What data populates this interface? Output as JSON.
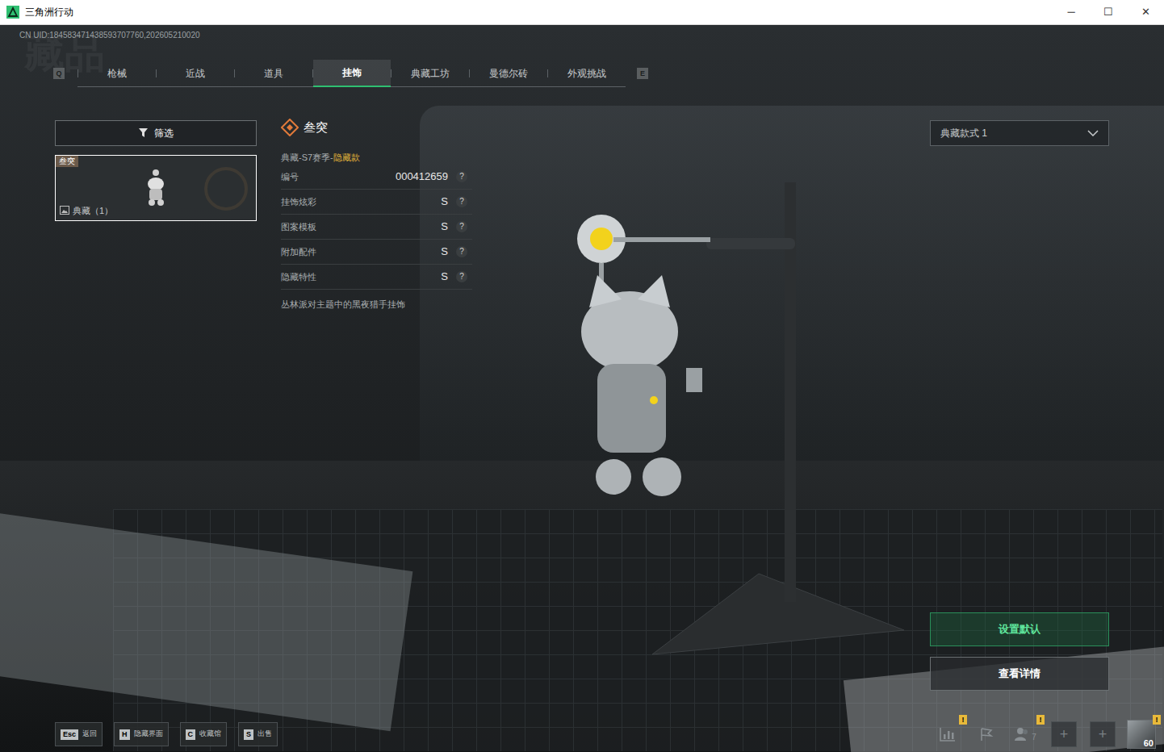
{
  "window": {
    "title": "三角洲行动",
    "controls": [
      "─",
      "☐",
      "✕"
    ]
  },
  "uid": "CN UID:184583471438593707760,202605210020",
  "watermark": "藏品",
  "tab_keys": {
    "prev": "Q",
    "next": "E"
  },
  "tabs": [
    {
      "label": "枪械",
      "selected": false
    },
    {
      "label": "近战",
      "selected": false
    },
    {
      "label": "道具",
      "selected": false
    },
    {
      "label": "挂饰",
      "selected": true
    },
    {
      "label": "典藏工坊",
      "selected": false
    },
    {
      "label": "曼德尔砖",
      "selected": false
    },
    {
      "label": "外观挑战",
      "selected": false
    }
  ],
  "filter": {
    "label": "筛选"
  },
  "items": [
    {
      "tag": "叁突",
      "label": "典藏（1）",
      "selected": true
    }
  ],
  "detail": {
    "title": "叁突",
    "series": "典藏-S7赛季-",
    "variant": "隐藏款",
    "rows": [
      {
        "label": "编号",
        "value": "000412659",
        "help": "?"
      },
      {
        "label": "挂饰炫彩",
        "value": "S",
        "help": "?"
      },
      {
        "label": "图案模板",
        "value": "S",
        "help": "?"
      },
      {
        "label": "附加配件",
        "value": "S",
        "help": "?"
      },
      {
        "label": "隐藏特性",
        "value": "S",
        "help": "?"
      }
    ],
    "description": "丛林派对主题中的黑夜猎手挂饰"
  },
  "style_select": {
    "value": "典藏款式 1"
  },
  "buttons": [
    {
      "label": "设置默认",
      "primary": true
    },
    {
      "label": "查看详情",
      "primary": false
    }
  ],
  "hotkeys": [
    {
      "key": "Esc",
      "label": "返回"
    },
    {
      "key": "H",
      "label": "隐藏界面"
    },
    {
      "key": "C",
      "label": "收藏馆"
    },
    {
      "key": "S",
      "label": "出售"
    }
  ],
  "tray": [
    {
      "kind": "stats",
      "badge": "!"
    },
    {
      "kind": "flag"
    },
    {
      "kind": "friends",
      "count": "7",
      "badge": "!"
    },
    {
      "kind": "slot",
      "symbol": "+"
    },
    {
      "kind": "slot",
      "symbol": "+"
    },
    {
      "kind": "avatar",
      "level": "60",
      "badge": "!"
    }
  ]
}
